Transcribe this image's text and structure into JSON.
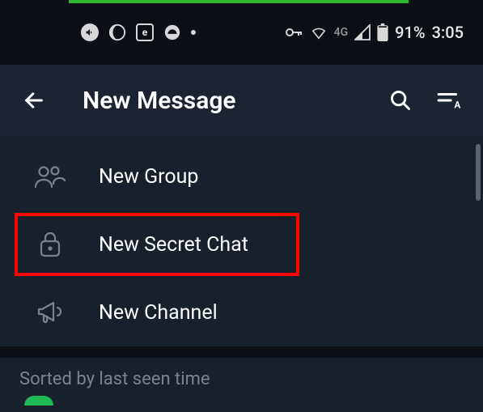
{
  "status_bar": {
    "battery_text": "91%",
    "time": "3:05",
    "network_label": "4G"
  },
  "app_bar": {
    "title": "New Message"
  },
  "options": {
    "new_group": "New Group",
    "new_secret_chat": "New Secret Chat",
    "new_channel": "New Channel"
  },
  "sort_label": "Sorted by last seen time"
}
